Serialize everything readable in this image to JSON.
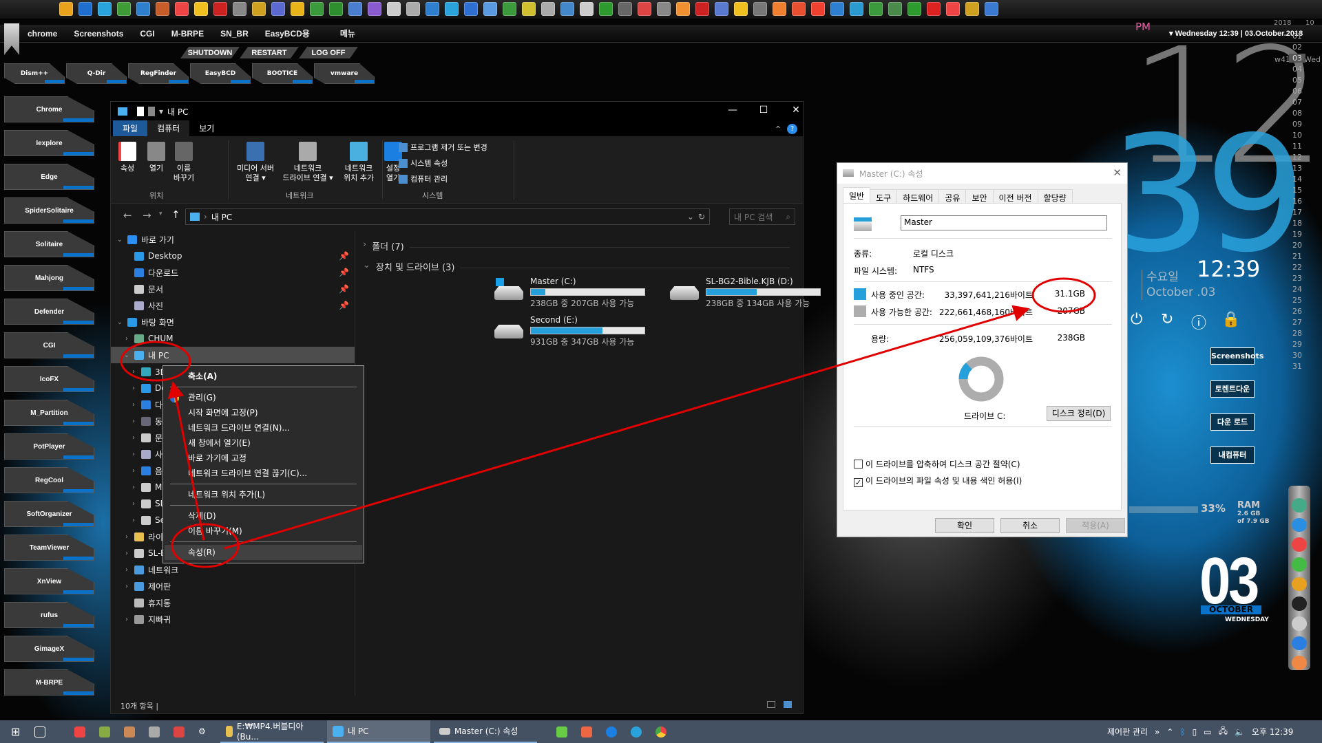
{
  "top_bar": {
    "icon_colors": [
      "#e9a21c",
      "#1f6fd1",
      "#2aa3dd",
      "#3f9b36",
      "#2f7fcf",
      "#c85d2a",
      "#e44",
      "#f0c020",
      "#c22",
      "#888",
      "#d0a020",
      "#5a6ad0",
      "#e8b418",
      "#3b9a3b",
      "#2d8f2d",
      "#4a7fd0",
      "#8a5ad0",
      "#ccc",
      "#aaa",
      "#2f7fd0",
      "#2aa3dd",
      "#2f6fd1",
      "#5a9ae0",
      "#3b9a3b",
      "#d0c030",
      "#aaa",
      "#48c",
      "#ccc",
      "#2c9a2c",
      "#666",
      "#d44",
      "#888",
      "#f09030",
      "#c22",
      "#5a7ad0",
      "#f0c020",
      "#777",
      "#f08030",
      "#e85030",
      "#f04030",
      "#2f7fd0",
      "#2a9ad0",
      "#3b9a3b",
      "#4a8a4a",
      "#2c9a2c",
      "#d22",
      "#e44",
      "#d0a020",
      "#3a7ad0"
    ]
  },
  "launcher": {
    "menu_items": [
      "chrome",
      "Screenshots",
      "CGI",
      "M-BRPE",
      "SN_BR",
      "EasyBCD용",
      "메뉴"
    ],
    "power_buttons": [
      "SHUTDOWN",
      "RESTART",
      "LOG OFF"
    ],
    "shortcuts": [
      "Dism++",
      "Q-Dir",
      "RegFinder",
      "EasyBCD",
      "BOOTICE",
      "vmware"
    ],
    "sidebar": [
      "Chrome",
      "Iexplore",
      "Edge",
      "SpiderSolitaire",
      "Solitaire",
      "Mahjong",
      "Defender",
      "CGI",
      "IcoFX",
      "M_Partition",
      "PotPlayer",
      "RegCool",
      "SoftOrganizer",
      "TeamViewer",
      "XnView",
      "rufus",
      "GimageX",
      "M-BRPE"
    ]
  },
  "explorer": {
    "title": "내 PC",
    "window_controls": {
      "minimize": "—",
      "maximize": "☐",
      "close": "✕"
    },
    "ribbon_tabs": [
      "파일",
      "컴퓨터",
      "보기"
    ],
    "ribbon": {
      "location_group": "위치",
      "network_group": "네트워크",
      "system_group": "시스템",
      "properties": "속성",
      "open": "열기",
      "rename": [
        "이름",
        "바꾸기"
      ],
      "media_server": [
        "미디어 서버",
        "연결 ▾"
      ],
      "map_drive": [
        "네트워크",
        "드라이브 연결 ▾"
      ],
      "add_location": [
        "네트워크",
        "위치 추가"
      ],
      "settings": [
        "설정",
        "열기"
      ],
      "uninstall": "프로그램 제거 또는 변경",
      "system_props": "시스템 속성",
      "computer_mgmt": "컴퓨터 관리"
    },
    "address": "내 PC",
    "search_placeholder": "내 PC 검색",
    "nav": [
      {
        "label": "바로 가기",
        "level": 0,
        "chev": "v",
        "color": "#2a8ff0"
      },
      {
        "label": "Desktop",
        "level": 1,
        "pin": true,
        "color": "#2a9ae8"
      },
      {
        "label": "다운로드",
        "level": 1,
        "pin": true,
        "color": "#2a7fe0"
      },
      {
        "label": "문서",
        "level": 1,
        "pin": true,
        "color": "#ccc"
      },
      {
        "label": "사진",
        "level": 1,
        "pin": true,
        "color": "#aac"
      },
      {
        "label": "바탕 화면",
        "level": 0,
        "chev": "v",
        "color": "#2a9ae8"
      },
      {
        "label": "CHUM",
        "level": 1,
        "chev": ">",
        "color": "#6a8"
      },
      {
        "label": "내 PC",
        "level": 1,
        "chev": "v",
        "color": "#4ab0f0",
        "selected": true
      },
      {
        "label": "3D 개체",
        "level": 2,
        "chev": ">",
        "color": "#3ab"
      },
      {
        "label": "Desktop",
        "level": 2,
        "chev": ">",
        "color": "#2a9ae8"
      },
      {
        "label": "다운로드",
        "level": 2,
        "chev": ">",
        "color": "#2a7fe0"
      },
      {
        "label": "동영상",
        "level": 2,
        "chev": ">",
        "color": "#667"
      },
      {
        "label": "문서",
        "level": 2,
        "chev": ">",
        "color": "#ccc"
      },
      {
        "label": "사진",
        "level": 2,
        "chev": ">",
        "color": "#aac"
      },
      {
        "label": "음악",
        "level": 2,
        "chev": ">",
        "color": "#2a7fe0"
      },
      {
        "label": "Master (C:)",
        "level": 2,
        "chev": ">",
        "color": "#ccc"
      },
      {
        "label": "SL-BG2-Bible.KJB (D:)",
        "level": 2,
        "chev": ">",
        "color": "#ccc"
      },
      {
        "label": "Second (E:)",
        "level": 2,
        "chev": ">",
        "color": "#ccc"
      },
      {
        "label": "라이브러리",
        "level": 1,
        "chev": ">",
        "color": "#e8c050"
      },
      {
        "label": "SL-BG2-Bible.KJB (D:)",
        "level": 1,
        "chev": ">",
        "color": "#ccc"
      },
      {
        "label": "네트워크",
        "level": 1,
        "chev": ">",
        "color": "#4a9ae0"
      },
      {
        "label": "제어판",
        "level": 1,
        "chev": ">",
        "color": "#4a9ae0"
      },
      {
        "label": "휴지통",
        "level": 1,
        "color": "#bbb"
      },
      {
        "label": "지빠귀",
        "level": 1,
        "chev": ">",
        "color": "#999"
      }
    ],
    "folders_header": "폴더 (7)",
    "drives_header": "장치 및 드라이브 (3)",
    "drives": [
      {
        "name": "Master (C:)",
        "detail": "238GB 중 207GB 사용 가능",
        "used_pct": 13,
        "system": true
      },
      {
        "name": "SL-BG2-Bible.KJB (D:)",
        "detail": "238GB 중 134GB 사용 가능",
        "used_pct": 44
      },
      {
        "name": "Second (E:)",
        "detail": "931GB 중 347GB 사용 가능",
        "used_pct": 63
      }
    ],
    "status": "10개 항목  |"
  },
  "context_menu": [
    {
      "label": "축소(A)",
      "bold": true
    },
    {
      "sep": true
    },
    {
      "label": "관리(G)",
      "shield": true
    },
    {
      "label": "시작 화면에 고정(P)"
    },
    {
      "label": "네트워크 드라이브 연결(N)..."
    },
    {
      "label": "새 창에서 열기(E)"
    },
    {
      "label": "바로 가기에 고정"
    },
    {
      "label": "네트워크 드라이브 연결 끊기(C)..."
    },
    {
      "sep": true
    },
    {
      "label": "네트워크 위치 추가(L)"
    },
    {
      "sep": true
    },
    {
      "label": "삭제(D)"
    },
    {
      "label": "이름 바꾸기(M)"
    },
    {
      "sep": true
    },
    {
      "label": "속성(R)",
      "highlight": true
    }
  ],
  "properties_dialog": {
    "title": "Master (C:) 속성",
    "tabs": [
      "일반",
      "도구",
      "하드웨어",
      "공유",
      "보안",
      "이전 버전",
      "할당량"
    ],
    "name_value": "Master",
    "type_label": "종류:",
    "type_value": "로컬 디스크",
    "fs_label": "파일 시스템:",
    "fs_value": "NTFS",
    "used_label": "사용 중인 공간:",
    "used_bytes": "33,397,641,216바이트",
    "used_size": "31.1GB",
    "free_label": "사용 가능한 공간:",
    "free_bytes": "222,661,468,160바이트",
    "free_size": "207GB",
    "cap_label": "용량:",
    "cap_bytes": "256,059,109,376바이트",
    "cap_size": "238GB",
    "used_fraction": 0.13,
    "used_color": "#26a0da",
    "free_color": "#adadad",
    "drive_label": "드라이브 C:",
    "cleanup": "디스크 정리(D)",
    "compress": "이 드라이브를 압축하여 디스크 공간 절약(C)",
    "compress_checked": false,
    "index": "이 드라이브의 파일 속성 및 내용 색인 허용(I)",
    "index_checked": true,
    "ok": "확인",
    "cancel": "취소",
    "apply": "적용(A)"
  },
  "desktop_widgets": {
    "ampm": "PM",
    "date_line": "▾ Wednesday 12:39 | 03.October.2018",
    "year": "2018",
    "month": "10",
    "week": "w41",
    "weekday_short": "Wed",
    "today": "03",
    "calendar_days": [
      "01",
      "02",
      "03",
      "04",
      "05",
      "06",
      "07",
      "08",
      "09",
      "10",
      "11",
      "12",
      "13",
      "14",
      "15",
      "16",
      "17",
      "18",
      "19",
      "20",
      "21",
      "22",
      "23",
      "24",
      "25",
      "26",
      "27",
      "28",
      "29",
      "30",
      "31"
    ],
    "big_hour": "12",
    "big_minute": "39",
    "small_time": "12:39",
    "weekday_kr": "수요일",
    "date_en": "October .03",
    "power_icons": [
      "⏻",
      "↻",
      "ⓘ",
      "🔒"
    ],
    "buttons": [
      "Screenshots",
      "토렌트다운",
      "다운 로드",
      "내컴퓨터"
    ],
    "ram_pct": "33%",
    "ram_label": "RAM",
    "ram_used": "2.6 GB",
    "ram_total": "of 7.9 GB",
    "day": "03",
    "month_name": "OCTOBER",
    "weekday": "WEDNESDAY",
    "dock_colors": [
      "#4a8",
      "#2a8fe0",
      "#e44",
      "#4b4",
      "#e8a020",
      "#222",
      "#ccc",
      "#2a7fe0",
      "#e84"
    ]
  },
  "taskbar": {
    "tasks": [
      "E:₩MP4.버블디아(Bu...",
      "내 PC",
      "Master (C:) 속성"
    ],
    "tray_label": "제어판 관리",
    "tray_more": "»",
    "clock": "오후 12:39"
  },
  "annotation_color": "#e00000"
}
